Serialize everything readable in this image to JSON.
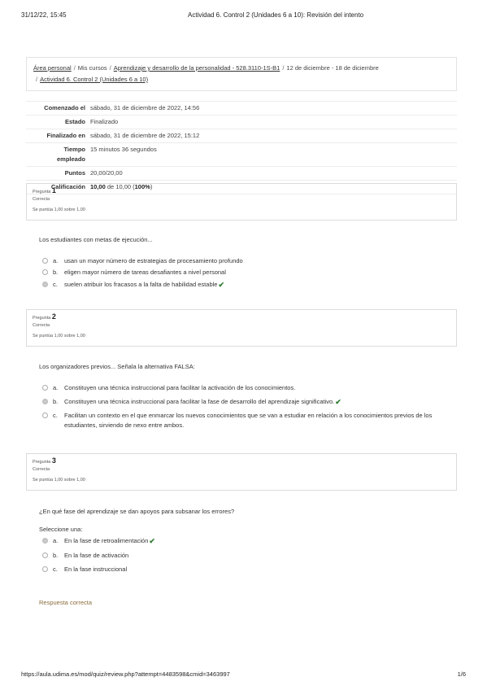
{
  "print_header": {
    "timestamp": "31/12/22, 15:45",
    "title": "Actividad 6. Control 2 (Unidades 6 a 10): Revisión del intento"
  },
  "print_footer": {
    "url": "https://aula.udima.es/mod/quiz/review.php?attempt=4483598&cmid=3463997",
    "page": "1/6"
  },
  "breadcrumb": {
    "item1": "Área personal",
    "item2": "Mis cursos",
    "item3": "Aprendizaje y desarrollo de la personalidad - 528.3110-1S-B1",
    "item4": "12 de diciembre - 18 de diciembre",
    "item5": "Actividad 6. Control 2 (Unidades 6 a 10)",
    "separator": "/"
  },
  "summary": {
    "started_label": "Comenzado el",
    "started_value": "sábado, 31 de diciembre de 2022, 14:56",
    "state_label": "Estado",
    "state_value": "Finalizado",
    "finished_label": "Finalizado en",
    "finished_value": "sábado, 31 de diciembre de 2022, 15:12",
    "time_label_1": "Tiempo",
    "time_label_2": "empleado",
    "time_value": "15 minutos 36 segundos",
    "points_label": "Puntos",
    "points_value": "20,00/20,00",
    "grade_label": "Calificación",
    "grade_value_bold": "10,00",
    "grade_value_mid": " de 10,00 (",
    "grade_value_pct": "100%",
    "grade_value_end": ")"
  },
  "questions": [
    {
      "prefix": "Pregunta",
      "number": "1",
      "status": "Correcta",
      "grade": "Se puntúa 1,00 sobre 1,00",
      "text": "Los estudiantes con metas de ejecución...",
      "options": [
        {
          "letter": "a.",
          "text": "usan un mayor número de estrategias de procesamiento profundo"
        },
        {
          "letter": "b.",
          "text": "eligen mayor número de tareas desafiantes a nivel personal"
        },
        {
          "letter": "c.",
          "text": "suelen atribuir los fracasos a la falta de habilidad estable"
        }
      ]
    },
    {
      "prefix": "Pregunta",
      "number": "2",
      "status": "Correcta",
      "grade": "Se puntúa 1,00 sobre 1,00",
      "text": "Los organizadores previos... Señala la alternativa FALSA:",
      "options": [
        {
          "letter": "a.",
          "text": "Constituyen una técnica instruccional para facilitar la activación de los conocimientos."
        },
        {
          "letter": "b.",
          "text": "Constituyen una técnica instruccional para facilitar la fase de desarrollo del aprendizaje significativo."
        },
        {
          "letter": "c.",
          "text": "Facilitan un contexto en el que enmarcar los nuevos conocimientos que se van a estudiar en relación a los conocimientos previos de los",
          "text2": "estudiantes, sirviendo de nexo entre ambos."
        }
      ]
    },
    {
      "prefix": "Pregunta",
      "number": "3",
      "status": "Correcta",
      "grade": "Se puntúa 1,00 sobre 1,00",
      "text": "¿En qué fase del aprendizaje se dan apoyos para subsanar los errores?",
      "prompt": "Seleccione una:",
      "options": [
        {
          "letter": "a.",
          "text": "En la fase de retroalimentación"
        },
        {
          "letter": "b.",
          "text": "En la fase de activación"
        },
        {
          "letter": "c.",
          "text": "En la fase instruccional"
        }
      ],
      "feedback": "Respuesta correcta"
    }
  ],
  "icons": {
    "correct": "check-icon",
    "correct_color": "#2e7d32",
    "feedback_color": "#8a6d3b"
  }
}
